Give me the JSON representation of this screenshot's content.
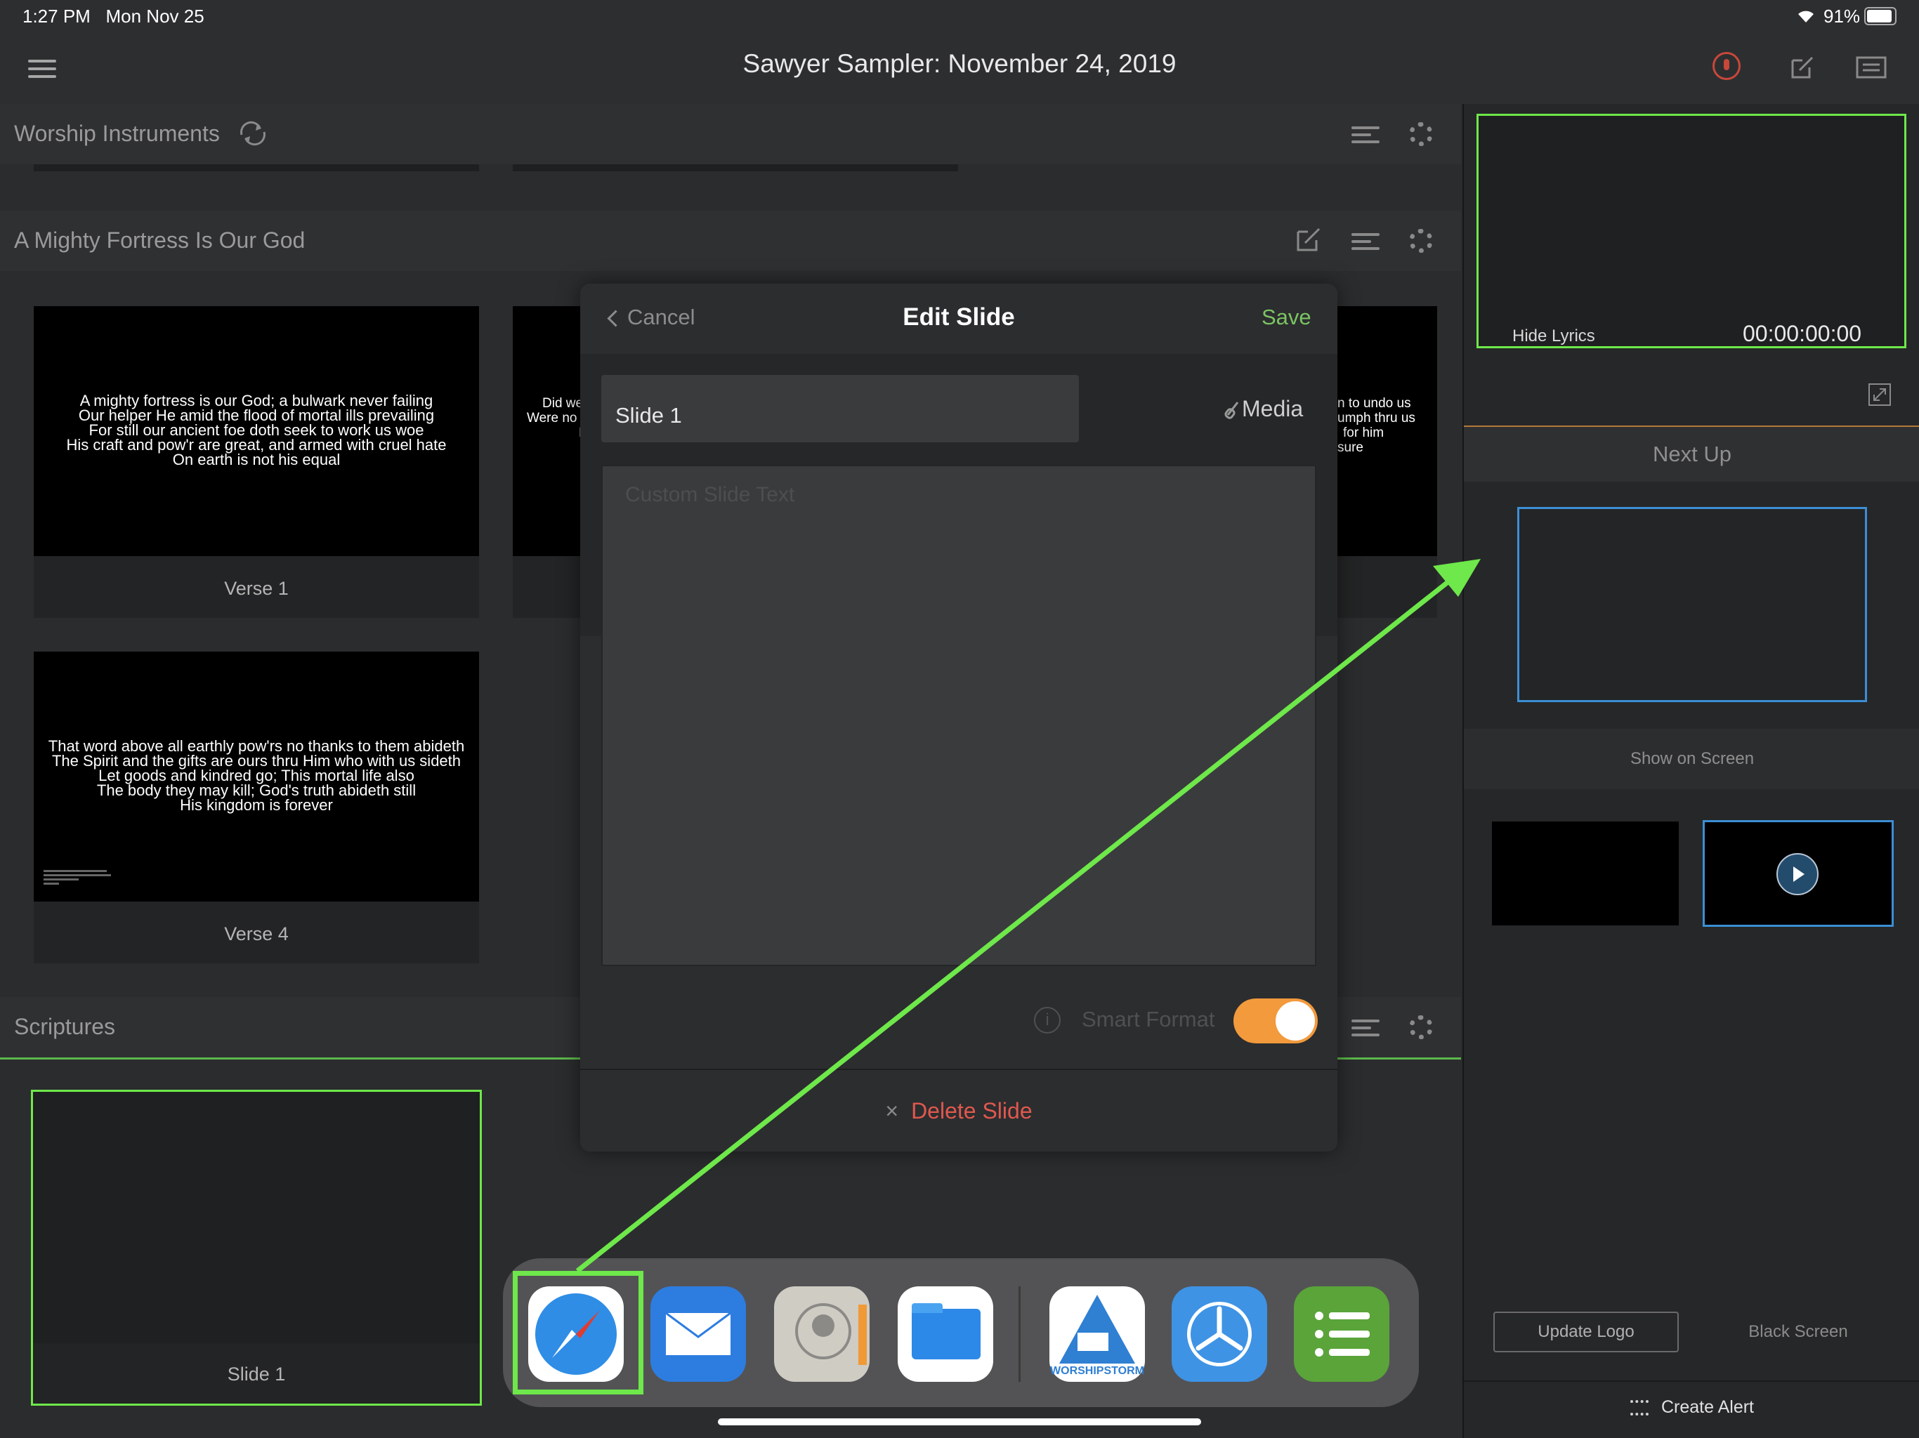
{
  "status_bar": {
    "time": "1:27 PM",
    "date": "Mon Nov 25",
    "battery": "91%"
  },
  "header": {
    "title": "Sawyer Sampler: November 24, 2019"
  },
  "sections": {
    "worship_instruments": {
      "title": "Worship Instruments"
    },
    "mighty_fortress": {
      "title": "A Mighty Fortress Is Our God",
      "slides": [
        {
          "label": "Verse 1",
          "lyrics": [
            "A mighty fortress is our God; a bulwark never failing",
            "Our helper He amid the flood of mortal ills prevailing",
            "For still our ancient foe doth seek to work us woe",
            "His craft and pow'r are great, and armed with cruel hate",
            "On earth is not his equal"
          ]
        },
        {
          "label": "",
          "lyrics": [
            "Did we",
            "Were no",
            "L"
          ]
        },
        {
          "label": "",
          "lyrics": [
            "n to undo us",
            "umph thru us",
            "for him",
            "sure"
          ]
        },
        {
          "label": "Verse 4",
          "lyrics": [
            "That word above all earthly pow'rs no thanks to them abideth",
            "The Spirit and the gifts are ours thru Him who with us sideth",
            "Let goods and kindred go; This mortal life also",
            "The body they may kill; God's truth abideth still",
            "His kingdom is forever"
          ]
        }
      ]
    },
    "scriptures": {
      "title": "Scriptures",
      "slides": [
        {
          "label": "Slide 1"
        }
      ]
    }
  },
  "right_panel": {
    "hide_lyrics": "Hide Lyrics",
    "timecode": "00:00:00:00",
    "next_up": "Next Up",
    "show_on_screen": "Show on Screen",
    "update_logo": "Update Logo",
    "black_screen": "Black Screen",
    "create_alert": "Create Alert"
  },
  "modal": {
    "cancel": "Cancel",
    "title": "Edit Slide",
    "save": "Save",
    "slide_name": "Slide 1",
    "media": "Media",
    "text_placeholder": "Custom Slide Text",
    "smart_format": "Smart Format",
    "smart_format_on": true,
    "delete": "Delete Slide"
  },
  "dock": {
    "apps": [
      "safari-icon",
      "mail-icon",
      "contacts-icon",
      "files-icon",
      "worshipstorm-icon",
      "testflight-icon",
      "numbers-icon"
    ],
    "worshipstorm_label": "WORSHIPSTORM"
  },
  "colors": {
    "accent_green": "#6ee84a",
    "save_green": "#7bc463",
    "delete_red": "#e0584e",
    "toggle_orange": "#f29a3c",
    "mic_red": "#c8483a",
    "next_up_blue": "#3b8fd4"
  }
}
